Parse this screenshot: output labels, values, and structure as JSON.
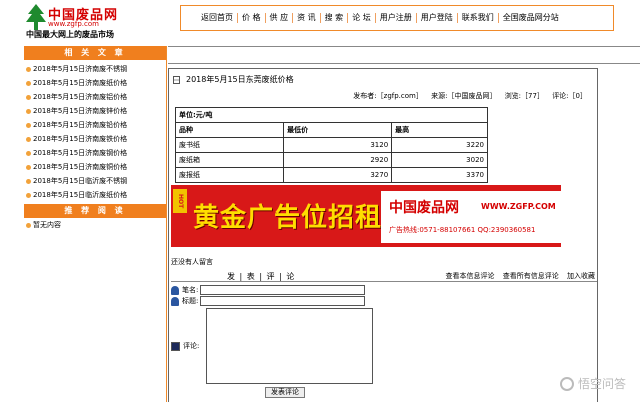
{
  "header": {
    "brand": "中国废品网",
    "url": "www.zgfp.com",
    "slogan": "中国最大网上的废品市场"
  },
  "topnav": [
    "返回首页",
    "价 格",
    "供 应",
    "资 讯",
    "搜 索",
    "论 坛",
    "用户注册",
    "用户登陆",
    "联系我们",
    "全国废品网分站"
  ],
  "sidebar": {
    "related_title": "相 关 文 章",
    "related_items": [
      "2018年5月15日济南废不锈钢",
      "2018年5月15日济南废纸价格",
      "2018年5月15日济南废铝价格",
      "2018年5月15日济南废锌价格",
      "2018年5月15日济南废铅价格",
      "2018年5月15日济南废铁价格",
      "2018年5月15日济南废钢价格",
      "2018年5月15日济南废铜价格",
      "2018年5月15日临沂废不锈钢",
      "2018年5月15日临沂废纸价格"
    ],
    "recommend_title": "推 荐 阅 读",
    "recommend_items": [
      "暂无内容"
    ]
  },
  "article": {
    "title": "2018年5月15日东莞废纸价格",
    "publisher": "发布者:［zgfp.com］",
    "source": "来源:［中国废品网］",
    "views": "浏览:［77］",
    "comments": "评论:［0］"
  },
  "price_table": {
    "unit": "单位:元/吨",
    "headers": [
      "品种",
      "最低价",
      "最高"
    ],
    "rows": [
      [
        "废书纸",
        "3120",
        "3220"
      ],
      [
        "废纸箱",
        "2920",
        "3020"
      ],
      [
        "废报纸",
        "3270",
        "3370"
      ]
    ]
  },
  "banner": {
    "hot": "HOT",
    "headline": "黄金广告位招租",
    "brand": "中国废品网",
    "url": "WWW.ZGFP.COM",
    "contact": "广告热线:0571-88107661  QQ:2390360581"
  },
  "comments": {
    "none": "还没有人留言",
    "form_title": "发 | 表 | 评 | 论",
    "links": [
      "查看本信息评论",
      "查看所有信息评论",
      "加入收藏"
    ],
    "name_label": "笔名:",
    "title_label": "标题:",
    "comment_label": "评论:",
    "submit": "发表评论"
  },
  "watermark": "悟空问答",
  "colors": {
    "accent": "#f07f1e",
    "brand_red": "#d40000",
    "banner_red": "#d81818",
    "banner_gold": "#ffdd00"
  }
}
